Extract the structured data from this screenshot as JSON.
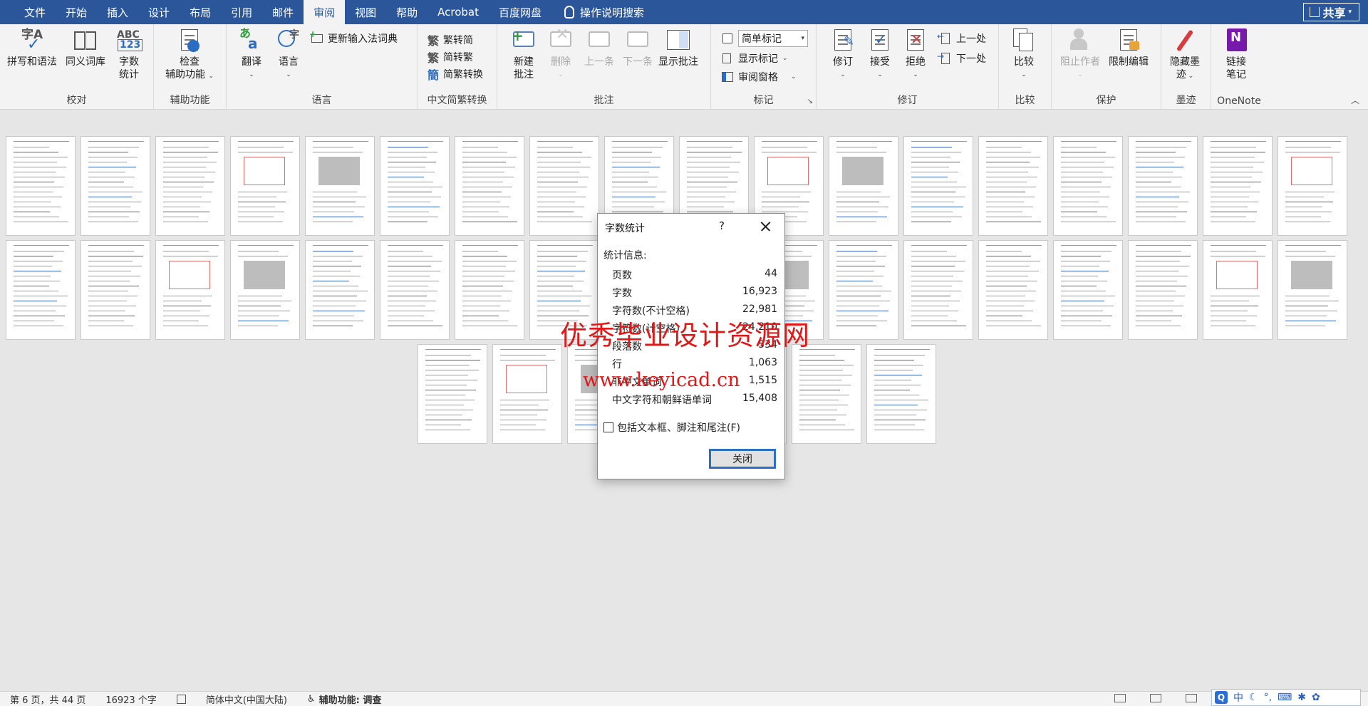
{
  "menubar": {
    "tabs": [
      {
        "label": "文件",
        "active": false
      },
      {
        "label": "开始",
        "active": false
      },
      {
        "label": "插入",
        "active": false
      },
      {
        "label": "设计",
        "active": false
      },
      {
        "label": "布局",
        "active": false
      },
      {
        "label": "引用",
        "active": false
      },
      {
        "label": "邮件",
        "active": false
      },
      {
        "label": "审阅",
        "active": true
      },
      {
        "label": "视图",
        "active": false
      },
      {
        "label": "帮助",
        "active": false
      },
      {
        "label": "Acrobat",
        "active": false
      },
      {
        "label": "百度网盘",
        "active": false
      }
    ],
    "search_label": "操作说明搜索",
    "share_label": "共享"
  },
  "ribbon": {
    "proofing": {
      "label": "校对",
      "spelling": "拼写和语法",
      "thesaurus": "同义词库",
      "wordcount_1": "字数",
      "wordcount_2": "统计"
    },
    "accessibility": {
      "label": "辅助功能",
      "check_1": "检查",
      "check_2": "辅助功能"
    },
    "language": {
      "label": "语言",
      "translate": "翻译",
      "language": "语言",
      "update_ime": "更新输入法词典"
    },
    "chinese_conversion": {
      "label": "中文简繁转换",
      "to_simplified": "繁转简",
      "to_traditional": "简转繁",
      "convert": "简繁转换"
    },
    "comments": {
      "label": "批注",
      "new_1": "新建",
      "new_2": "批注",
      "delete": "删除",
      "previous": "上一条",
      "next": "下一条",
      "show": "显示批注"
    },
    "tracking": {
      "label": "标记",
      "markup_select": "简单标记",
      "show_markup": "显示标记",
      "reviewing_pane": "审阅窗格"
    },
    "changes": {
      "label": "修订",
      "track": "修订",
      "accept": "接受",
      "reject": "拒绝",
      "previous": "上一处",
      "next": "下一处"
    },
    "compare": {
      "label": "比较",
      "compare": "比较"
    },
    "protect": {
      "label": "保护",
      "block_authors": "阻止作者",
      "restrict": "限制编辑"
    },
    "ink": {
      "label": "墨迹",
      "hide_ink_1": "隐藏墨",
      "hide_ink_2": "迹"
    },
    "onenote": {
      "label": "OneNote",
      "linked_1": "链接",
      "linked_2": "笔记"
    }
  },
  "dialog": {
    "title": "字数统计",
    "help": "?",
    "section": "统计信息:",
    "rows": [
      {
        "label": "页数",
        "value": "44"
      },
      {
        "label": "字数",
        "value": "16,923"
      },
      {
        "label": "字符数(不计空格)",
        "value": "22,981"
      },
      {
        "label": "字符数(计空格)",
        "value": "24,210"
      },
      {
        "label": "段落数",
        "value": "534"
      },
      {
        "label": "行",
        "value": "1,063"
      },
      {
        "label": "非中文单词",
        "value": "1,515"
      },
      {
        "label": "中文字符和朝鲜语单词",
        "value": "15,408"
      }
    ],
    "checkbox_label": "包括文本框、脚注和尾注(F)",
    "close_label": "关闭"
  },
  "watermark": {
    "text": "优秀毕业设计资源网",
    "url": "www.keyicad.cn"
  },
  "statusbar": {
    "page": "第 6 页，共 44 页",
    "words": "16923 个字",
    "language": "简体中文(中国大陆)",
    "accessibility": "辅助功能: 调查"
  },
  "ime": {
    "mode": "中"
  }
}
